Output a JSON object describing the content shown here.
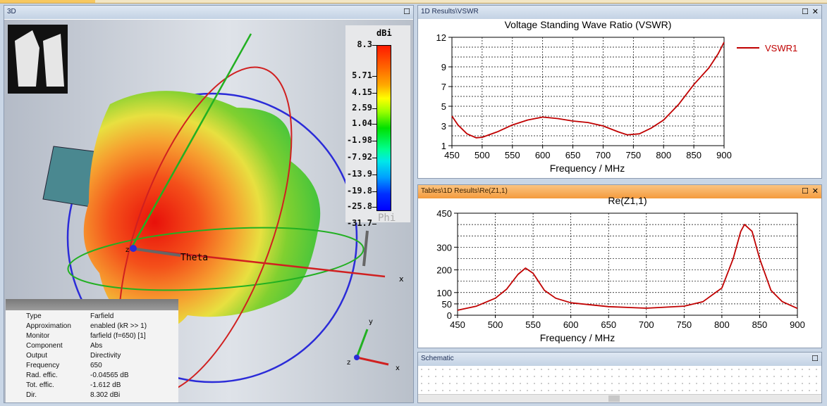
{
  "panels": {
    "view3d": {
      "title": "3D",
      "legend_unit": "dBi",
      "legend_ticks": [
        "8.3",
        "5.71",
        "4.15",
        "2.59",
        "1.04",
        "-1.98",
        "-7.92",
        "-13.9",
        "-19.8",
        "-25.8",
        "-31.7"
      ],
      "axis_labels": {
        "theta": "Theta",
        "phi": "Phi",
        "z": "z",
        "x": "x",
        "y": "y"
      },
      "info": [
        [
          "Type",
          "Farfield"
        ],
        [
          "Approximation",
          "enabled (kR >> 1)"
        ],
        [
          "Monitor",
          "farfield (f=650) [1]"
        ],
        [
          "Component",
          "Abs"
        ],
        [
          "Output",
          "Directivity"
        ],
        [
          "Frequency",
          "650"
        ],
        [
          "Rad. effic.",
          "-0.04565 dB"
        ],
        [
          "Tot. effic.",
          "-1.612 dB"
        ],
        [
          "Dir.",
          "8.302 dBi"
        ]
      ]
    },
    "vswr": {
      "title": "1D Results\\VSWR"
    },
    "rez": {
      "title": "Tables\\1D Results\\Re(Z1,1)"
    },
    "schematic": {
      "title": "Schematic"
    }
  },
  "icons": {
    "maximize": "maximize-icon",
    "close": "close-icon"
  },
  "colors": {
    "curve": "#c00000",
    "active_header": "#f49b3d"
  },
  "chart_data": [
    {
      "type": "line",
      "title": "Voltage Standing Wave Ratio (VSWR)",
      "xlabel": "Frequency / MHz",
      "ylabel": "",
      "xlim": [
        450,
        900
      ],
      "ylim": [
        1,
        12
      ],
      "xticks": [
        450,
        500,
        550,
        600,
        650,
        700,
        750,
        800,
        850,
        900
      ],
      "yticks": [
        1,
        3,
        5,
        7,
        9,
        12
      ],
      "grid": true,
      "legend": "top-right",
      "series": [
        {
          "name": "VSWR1",
          "x": [
            450,
            460,
            475,
            490,
            500,
            525,
            550,
            575,
            600,
            625,
            650,
            675,
            700,
            725,
            740,
            760,
            780,
            800,
            825,
            850,
            875,
            890,
            900
          ],
          "y": [
            4.0,
            3.1,
            2.2,
            1.8,
            1.85,
            2.4,
            3.1,
            3.6,
            3.9,
            3.75,
            3.5,
            3.35,
            3.0,
            2.4,
            2.1,
            2.2,
            2.8,
            3.6,
            5.2,
            7.2,
            8.9,
            10.3,
            11.5
          ]
        }
      ]
    },
    {
      "type": "line",
      "title": "Re(Z1,1)",
      "xlabel": "Frequency / MHz",
      "ylabel": "",
      "xlim": [
        450,
        900
      ],
      "ylim": [
        0,
        450
      ],
      "xticks": [
        450,
        500,
        550,
        600,
        650,
        700,
        750,
        800,
        850,
        900
      ],
      "yticks": [
        0,
        50,
        100,
        200,
        300,
        450
      ],
      "grid": true,
      "series": [
        {
          "x": [
            450,
            475,
            500,
            515,
            530,
            540,
            550,
            565,
            580,
            600,
            650,
            700,
            750,
            775,
            800,
            815,
            825,
            830,
            840,
            850,
            865,
            880,
            900
          ],
          "y": [
            22,
            40,
            75,
            115,
            180,
            208,
            185,
            110,
            75,
            55,
            38,
            31,
            40,
            60,
            120,
            250,
            370,
            400,
            370,
            250,
            110,
            60,
            30
          ]
        }
      ]
    }
  ]
}
